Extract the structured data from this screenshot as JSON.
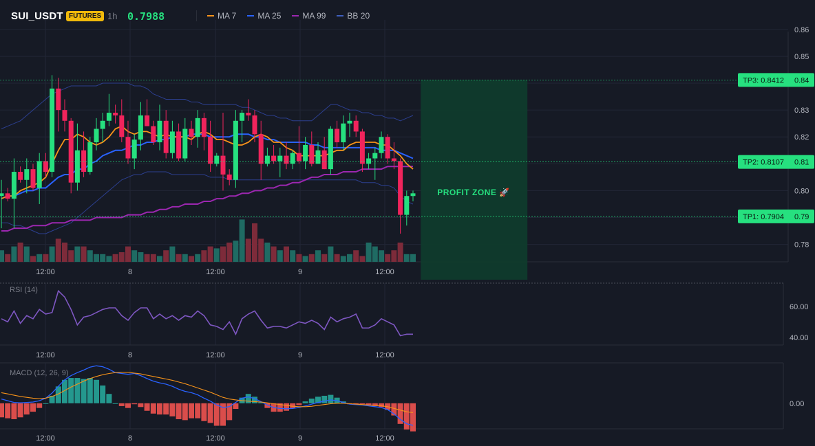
{
  "header": {
    "symbol": "SUI_USDT",
    "badge": "FUTURES",
    "interval": "1h",
    "price": "0.7988"
  },
  "legend": [
    {
      "label": "MA 7",
      "color": "#f7931a"
    },
    {
      "label": "MA 25",
      "color": "#2962ff"
    },
    {
      "label": "MA 99",
      "color": "#9c27b0"
    },
    {
      "label": "BB 20",
      "color": "#1e3a8a"
    }
  ],
  "colors": {
    "up": "#26e07f",
    "down": "#f0245c",
    "tp": "#26e07f",
    "zone": "#0f3b2c"
  },
  "time_axis": [
    "12:00",
    "8",
    "12:00",
    "9",
    "12:00"
  ],
  "price_axis": {
    "ylim": [
      0.7735,
      0.8615
    ],
    "ticks": [
      "0.86",
      "0.85",
      "0.84",
      "0.83",
      "0.82",
      "0.81",
      "0.80",
      "0.79",
      "0.78"
    ]
  },
  "targets": [
    {
      "label": "TP3: 0.8412",
      "axis_value": "0.84",
      "value": 0.8412
    },
    {
      "label": "TP2: 0.8107",
      "axis_value": "0.81",
      "value": 0.8107
    },
    {
      "label": "TP1: 0.7904",
      "axis_value": "0.79",
      "value": 0.7904
    }
  ],
  "profit_zone": {
    "label": "PROFIT ZONE 🚀",
    "from": 0.7904,
    "to": 0.8412
  },
  "rsi": {
    "title": "RSI (14)",
    "ticks": [
      "60.00",
      "40.00"
    ],
    "ylim": [
      35,
      75
    ],
    "values": [
      52,
      50,
      57,
      49,
      54,
      52,
      58,
      55,
      56,
      70,
      66,
      58,
      48,
      53,
      54,
      56,
      58,
      59,
      59,
      54,
      51,
      56,
      59,
      59,
      52,
      55,
      52,
      54,
      51,
      54,
      53,
      57,
      54,
      48,
      47,
      45,
      50,
      42,
      52,
      55,
      57,
      51,
      46,
      47,
      47,
      46,
      48,
      50,
      49,
      51,
      49,
      45,
      53,
      50,
      52,
      53,
      55,
      46,
      46,
      48,
      52,
      50,
      48,
      41,
      42,
      42
    ]
  },
  "macd": {
    "title": "MACD (12, 26, 9)",
    "ticks": [
      "0.00"
    ],
    "ylim": [
      -0.006,
      0.0095
    ]
  },
  "chart_data": {
    "type": "candlestick",
    "title": "SUI_USDT",
    "x": [
      "12:00",
      "8",
      "12:00",
      "9",
      "12:00"
    ],
    "ylim": [
      0.7735,
      0.8615
    ],
    "series": [
      {
        "name": "price",
        "type": "candlestick",
        "ohlc": [
          [
            0.798,
            0.804,
            0.786,
            0.799
          ],
          [
            0.799,
            0.801,
            0.796,
            0.797
          ],
          [
            0.797,
            0.812,
            0.786,
            0.807
          ],
          [
            0.807,
            0.809,
            0.803,
            0.804
          ],
          [
            0.804,
            0.812,
            0.799,
            0.808
          ],
          [
            0.808,
            0.81,
            0.8,
            0.801
          ],
          [
            0.801,
            0.814,
            0.795,
            0.811
          ],
          [
            0.811,
            0.814,
            0.805,
            0.807
          ],
          [
            0.807,
            0.843,
            0.805,
            0.838
          ],
          [
            0.838,
            0.842,
            0.822,
            0.83
          ],
          [
            0.83,
            0.834,
            0.822,
            0.826
          ],
          [
            0.826,
            0.827,
            0.799,
            0.803
          ],
          [
            0.803,
            0.825,
            0.8,
            0.815
          ],
          [
            0.815,
            0.822,
            0.805,
            0.807
          ],
          [
            0.807,
            0.82,
            0.806,
            0.818
          ],
          [
            0.818,
            0.827,
            0.815,
            0.823
          ],
          [
            0.823,
            0.829,
            0.818,
            0.826
          ],
          [
            0.826,
            0.836,
            0.824,
            0.829
          ],
          [
            0.829,
            0.832,
            0.825,
            0.828
          ],
          [
            0.828,
            0.834,
            0.818,
            0.82
          ],
          [
            0.82,
            0.826,
            0.81,
            0.812
          ],
          [
            0.812,
            0.821,
            0.808,
            0.819
          ],
          [
            0.819,
            0.833,
            0.815,
            0.828
          ],
          [
            0.828,
            0.834,
            0.824,
            0.824
          ],
          [
            0.824,
            0.826,
            0.817,
            0.818
          ],
          [
            0.818,
            0.832,
            0.815,
            0.826
          ],
          [
            0.826,
            0.83,
            0.812,
            0.814
          ],
          [
            0.814,
            0.826,
            0.812,
            0.822
          ],
          [
            0.822,
            0.825,
            0.811,
            0.812
          ],
          [
            0.812,
            0.827,
            0.811,
            0.823
          ],
          [
            0.823,
            0.826,
            0.817,
            0.82
          ],
          [
            0.82,
            0.83,
            0.816,
            0.827
          ],
          [
            0.827,
            0.829,
            0.815,
            0.82
          ],
          [
            0.82,
            0.826,
            0.807,
            0.81
          ],
          [
            0.81,
            0.814,
            0.809,
            0.813
          ],
          [
            0.813,
            0.829,
            0.8,
            0.806
          ],
          [
            0.806,
            0.808,
            0.802,
            0.804
          ],
          [
            0.804,
            0.83,
            0.801,
            0.826
          ],
          [
            0.826,
            0.83,
            0.818,
            0.829
          ],
          [
            0.829,
            0.834,
            0.826,
            0.828
          ],
          [
            0.828,
            0.83,
            0.818,
            0.821
          ],
          [
            0.821,
            0.826,
            0.804,
            0.81
          ],
          [
            0.81,
            0.816,
            0.809,
            0.813
          ],
          [
            0.813,
            0.817,
            0.81,
            0.811
          ],
          [
            0.811,
            0.816,
            0.805,
            0.813
          ],
          [
            0.813,
            0.818,
            0.808,
            0.81
          ],
          [
            0.81,
            0.815,
            0.808,
            0.814
          ],
          [
            0.814,
            0.824,
            0.81,
            0.811
          ],
          [
            0.811,
            0.82,
            0.808,
            0.817
          ],
          [
            0.817,
            0.822,
            0.809,
            0.81
          ],
          [
            0.81,
            0.818,
            0.81,
            0.815
          ],
          [
            0.815,
            0.82,
            0.808,
            0.808
          ],
          [
            0.808,
            0.824,
            0.806,
            0.823
          ],
          [
            0.823,
            0.826,
            0.816,
            0.818
          ],
          [
            0.818,
            0.828,
            0.815,
            0.825
          ],
          [
            0.825,
            0.829,
            0.82,
            0.826
          ],
          [
            0.826,
            0.828,
            0.82,
            0.822
          ],
          [
            0.822,
            0.823,
            0.807,
            0.81
          ],
          [
            0.81,
            0.814,
            0.808,
            0.812
          ],
          [
            0.812,
            0.816,
            0.804,
            0.814
          ],
          [
            0.814,
            0.822,
            0.812,
            0.82
          ],
          [
            0.82,
            0.821,
            0.81,
            0.812
          ],
          [
            0.812,
            0.818,
            0.808,
            0.811
          ],
          [
            0.811,
            0.812,
            0.784,
            0.791
          ],
          [
            0.791,
            0.8,
            0.787,
            0.798
          ],
          [
            0.798,
            0.8,
            0.796,
            0.799
          ]
        ]
      },
      {
        "name": "MA 7",
        "type": "line",
        "values": [
          0.797,
          0.798,
          0.798,
          0.8,
          0.801,
          0.802,
          0.803,
          0.805,
          0.81,
          0.815,
          0.819,
          0.819,
          0.821,
          0.82,
          0.818,
          0.817,
          0.818,
          0.82,
          0.823,
          0.824,
          0.822,
          0.821,
          0.822,
          0.822,
          0.821,
          0.82,
          0.821,
          0.82,
          0.82,
          0.82,
          0.819,
          0.821,
          0.822,
          0.821,
          0.819,
          0.819,
          0.818,
          0.817,
          0.817,
          0.818,
          0.82,
          0.821,
          0.82,
          0.818,
          0.818,
          0.816,
          0.815,
          0.813,
          0.813,
          0.813,
          0.813,
          0.813,
          0.814,
          0.815,
          0.815,
          0.817,
          0.818,
          0.818,
          0.818,
          0.818,
          0.817,
          0.817,
          0.815,
          0.813,
          0.81,
          0.808
        ]
      },
      {
        "name": "MA 25",
        "type": "line",
        "values": [
          0.797,
          0.798,
          0.798,
          0.799,
          0.8,
          0.8,
          0.801,
          0.801,
          0.803,
          0.805,
          0.806,
          0.806,
          0.808,
          0.808,
          0.81,
          0.811,
          0.813,
          0.814,
          0.815,
          0.815,
          0.816,
          0.817,
          0.817,
          0.818,
          0.818,
          0.819,
          0.819,
          0.82,
          0.82,
          0.82,
          0.821,
          0.821,
          0.821,
          0.82,
          0.82,
          0.82,
          0.82,
          0.821,
          0.821,
          0.821,
          0.82,
          0.82,
          0.819,
          0.819,
          0.818,
          0.818,
          0.818,
          0.818,
          0.818,
          0.817,
          0.817,
          0.816,
          0.816,
          0.816,
          0.816,
          0.816,
          0.816,
          0.816,
          0.816,
          0.816,
          0.815,
          0.815,
          0.815,
          0.814,
          0.813,
          0.812
        ]
      },
      {
        "name": "MA 99",
        "type": "line",
        "values": [
          0.785,
          0.785,
          0.786,
          0.786,
          0.786,
          0.787,
          0.787,
          0.787,
          0.788,
          0.788,
          0.788,
          0.789,
          0.789,
          0.789,
          0.789,
          0.79,
          0.79,
          0.79,
          0.79,
          0.79,
          0.791,
          0.791,
          0.791,
          0.792,
          0.792,
          0.793,
          0.793,
          0.794,
          0.794,
          0.795,
          0.795,
          0.795,
          0.796,
          0.796,
          0.797,
          0.797,
          0.798,
          0.798,
          0.799,
          0.799,
          0.8,
          0.8,
          0.801,
          0.801,
          0.802,
          0.802,
          0.803,
          0.803,
          0.804,
          0.805,
          0.805,
          0.806,
          0.806,
          0.806,
          0.807,
          0.807,
          0.807,
          0.808,
          0.808,
          0.808,
          0.808,
          0.809,
          0.809,
          0.809,
          0.809,
          0.809
        ]
      },
      {
        "name": "BB 20",
        "type": "band",
        "upper": [
          0.823,
          0.824,
          0.825,
          0.826,
          0.828,
          0.83,
          0.832,
          0.834,
          0.836,
          0.837,
          0.838,
          0.839,
          0.839,
          0.839,
          0.839,
          0.839,
          0.84,
          0.84,
          0.84,
          0.84,
          0.84,
          0.839,
          0.839,
          0.838,
          0.836,
          0.835,
          0.834,
          0.834,
          0.834,
          0.834,
          0.833,
          0.833,
          0.832,
          0.832,
          0.832,
          0.832,
          0.832,
          0.832,
          0.831,
          0.831,
          0.83,
          0.829,
          0.828,
          0.828,
          0.827,
          0.827,
          0.826,
          0.826,
          0.826,
          0.826,
          0.828,
          0.83,
          0.832,
          0.832,
          0.831,
          0.83,
          0.83,
          0.829,
          0.829,
          0.828,
          0.828,
          0.827,
          0.827,
          0.826,
          0.827,
          0.828
        ],
        "lower": [
          0.788,
          0.788,
          0.787,
          0.787,
          0.786,
          0.785,
          0.784,
          0.784,
          0.785,
          0.786,
          0.787,
          0.788,
          0.79,
          0.792,
          0.794,
          0.796,
          0.798,
          0.8,
          0.802,
          0.804,
          0.805,
          0.806,
          0.806,
          0.807,
          0.807,
          0.807,
          0.807,
          0.806,
          0.806,
          0.806,
          0.806,
          0.806,
          0.806,
          0.805,
          0.805,
          0.805,
          0.804,
          0.804,
          0.804,
          0.804,
          0.804,
          0.804,
          0.804,
          0.804,
          0.804,
          0.804,
          0.804,
          0.804,
          0.804,
          0.804,
          0.804,
          0.804,
          0.804,
          0.804,
          0.804,
          0.804,
          0.804,
          0.803,
          0.803,
          0.803,
          0.802,
          0.802,
          0.801,
          0.798,
          0.796,
          0.795
        ]
      },
      {
        "name": "volume",
        "type": "bar",
        "values": [
          3,
          2,
          4,
          5,
          4,
          1.5,
          2,
          2,
          4,
          6,
          5,
          3,
          4,
          4,
          3,
          2,
          2,
          1.5,
          2,
          2.5,
          4,
          3,
          2.5,
          2,
          2,
          1.5,
          3,
          4,
          2,
          2,
          1.5,
          2,
          3,
          4,
          3.5,
          4,
          5,
          5.5,
          11,
          6,
          10,
          6,
          5,
          4,
          3,
          4,
          3,
          2,
          1.5,
          2,
          3,
          2,
          4,
          2,
          1.5,
          2,
          3,
          1.5,
          5,
          4,
          3,
          2,
          3,
          5,
          2,
          2
        ]
      },
      {
        "name": "RSI (14)",
        "type": "line",
        "values": [
          52,
          50,
          57,
          49,
          54,
          52,
          58,
          55,
          56,
          70,
          66,
          58,
          48,
          53,
          54,
          56,
          58,
          59,
          59,
          54,
          51,
          56,
          59,
          59,
          52,
          55,
          52,
          54,
          51,
          54,
          53,
          57,
          54,
          48,
          47,
          45,
          50,
          42,
          52,
          55,
          57,
          51,
          46,
          47,
          47,
          46,
          48,
          50,
          49,
          51,
          49,
          45,
          53,
          50,
          52,
          53,
          55,
          46,
          46,
          48,
          52,
          50,
          48,
          41,
          42,
          42
        ]
      },
      {
        "name": "MACD (12, 26, 9)",
        "type": "line",
        "values": [
          0.001,
          0.0006,
          0.0002,
          0.0001,
          0.0002,
          0.0003,
          0.0006,
          0.0012,
          0.0024,
          0.004,
          0.0055,
          0.0065,
          0.0072,
          0.0078,
          0.0085,
          0.0088,
          0.0086,
          0.008,
          0.0072,
          0.007,
          0.0068,
          0.007,
          0.0065,
          0.0058,
          0.0052,
          0.0048,
          0.0045,
          0.004,
          0.0033,
          0.0028,
          0.0025,
          0.002,
          0.0012,
          0.0005,
          -0.0004,
          -0.001,
          -0.0008,
          0.0002,
          0.0012,
          0.0015,
          0.0011,
          0.0004,
          -0.0004,
          -0.001,
          -0.0012,
          -0.0013,
          -0.0012,
          -0.001,
          -0.0006,
          -0.0002,
          0.0002,
          0.0005,
          0.0008,
          0.0006,
          0.0002,
          -0.0002,
          -0.0003,
          -0.0004,
          -0.0006,
          -0.0008,
          -0.001,
          -0.0015,
          -0.0025,
          -0.0038,
          -0.0048,
          -0.0052
        ]
      },
      {
        "name": "MACD signal",
        "type": "line",
        "values": [
          0.0025,
          0.0022,
          0.0019,
          0.0016,
          0.0014,
          0.0012,
          0.0011,
          0.0012,
          0.0016,
          0.0022,
          0.003,
          0.0038,
          0.0045,
          0.0052,
          0.0058,
          0.0063,
          0.0067,
          0.007,
          0.0072,
          0.0073,
          0.0073,
          0.0071,
          0.0069,
          0.0066,
          0.0063,
          0.006,
          0.0057,
          0.0054,
          0.005,
          0.0046,
          0.0041,
          0.0036,
          0.0031,
          0.0026,
          0.002,
          0.0014,
          0.001,
          0.0008,
          0.0006,
          0.0005,
          0.0004,
          0.0003,
          0.0001,
          -0.0001,
          -0.0003,
          -0.0005,
          -0.0007,
          -0.0008,
          -0.0008,
          -0.0007,
          -0.0005,
          -0.0003,
          -0.0001,
          0.0,
          0.0,
          -0.0001,
          -0.0002,
          -0.0003,
          -0.0004,
          -0.0005,
          -0.0006,
          -0.0008,
          -0.0012,
          -0.0016,
          -0.002,
          -0.0022
        ]
      }
    ]
  }
}
